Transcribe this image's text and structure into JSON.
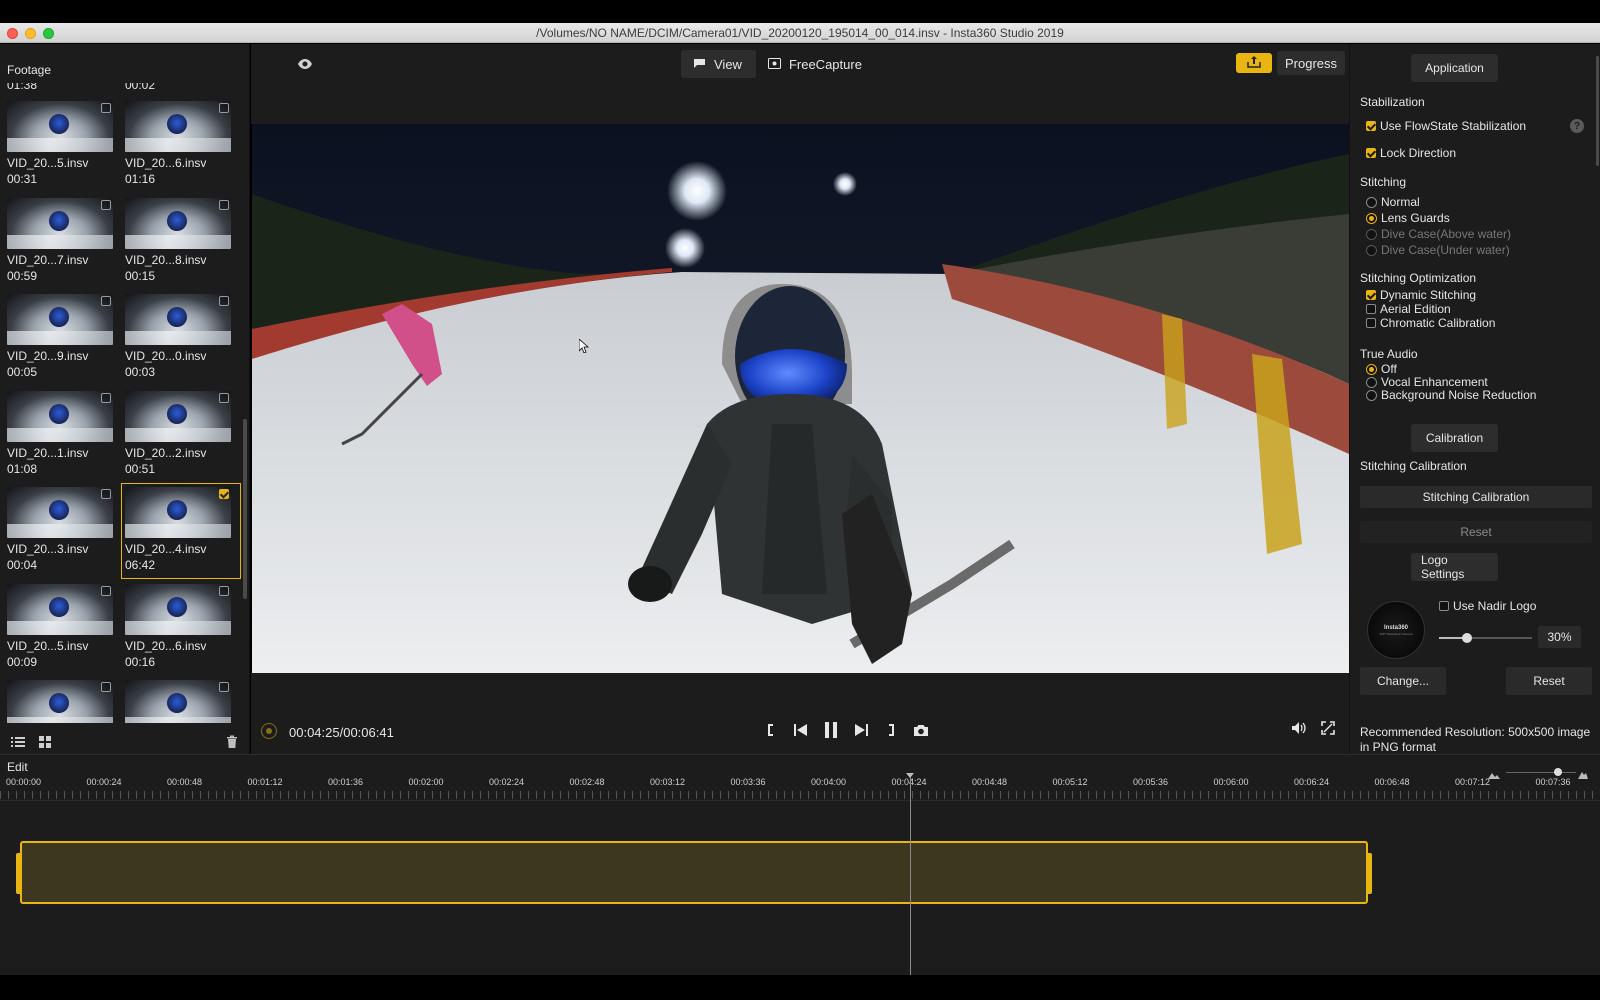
{
  "window": {
    "title": "/Volumes/NO NAME/DCIM/Camera01/VID_20200120_195014_00_014.insv - Insta360 Studio 2019"
  },
  "sidebar": {
    "header": "Footage",
    "top_partial": [
      "01:38",
      "00:02"
    ],
    "thumbnails": [
      {
        "name": "VID_20...5.insv",
        "duration": "00:31",
        "selected": false
      },
      {
        "name": "VID_20...6.insv",
        "duration": "01:16",
        "selected": false
      },
      {
        "name": "VID_20...7.insv",
        "duration": "00:59",
        "selected": false
      },
      {
        "name": "VID_20...8.insv",
        "duration": "00:15",
        "selected": false
      },
      {
        "name": "VID_20...9.insv",
        "duration": "00:05",
        "selected": false
      },
      {
        "name": "VID_20...0.insv",
        "duration": "00:03",
        "selected": false
      },
      {
        "name": "VID_20...1.insv",
        "duration": "01:08",
        "selected": false
      },
      {
        "name": "VID_20...2.insv",
        "duration": "00:51",
        "selected": false
      },
      {
        "name": "VID_20...3.insv",
        "duration": "00:04",
        "selected": false
      },
      {
        "name": "VID_20...4.insv",
        "duration": "06:42",
        "selected": true
      },
      {
        "name": "VID_20...5.insv",
        "duration": "00:09",
        "selected": false
      },
      {
        "name": "VID_20...6.insv",
        "duration": "00:16",
        "selected": false
      },
      {
        "name": "",
        "duration": "",
        "selected": false
      },
      {
        "name": "",
        "duration": "",
        "selected": false
      }
    ]
  },
  "viewer": {
    "tabs": [
      {
        "label": "View",
        "icon": "flag-icon",
        "active": true
      },
      {
        "label": "FreeCapture",
        "icon": "capture-icon",
        "active": false
      }
    ],
    "progress_label": "Progress",
    "timecode": "00:04:25/00:06:41"
  },
  "right_panel": {
    "application_tab": "Application",
    "stabilization": {
      "title": "Stabilization",
      "flowstate": {
        "label": "Use FlowState Stabilization",
        "checked": true
      },
      "lock_direction": {
        "label": "Lock Direction",
        "checked": true
      },
      "help": "?"
    },
    "stitching": {
      "title": "Stitching",
      "options": [
        {
          "label": "Normal",
          "selected": false,
          "disabled": false
        },
        {
          "label": "Lens Guards",
          "selected": true,
          "disabled": false
        },
        {
          "label": "Dive Case(Above water)",
          "selected": false,
          "disabled": true
        },
        {
          "label": "Dive Case(Under water)",
          "selected": false,
          "disabled": true
        }
      ]
    },
    "stitching_optimization": {
      "title": "Stitching Optimization",
      "options": [
        {
          "label": "Dynamic Stitching",
          "checked": true
        },
        {
          "label": "Aerial Edition",
          "checked": false
        },
        {
          "label": "Chromatic Calibration",
          "checked": false
        }
      ]
    },
    "true_audio": {
      "title": "True Audio",
      "options": [
        {
          "label": "Off",
          "selected": true
        },
        {
          "label": "Vocal Enhancement",
          "selected": false
        },
        {
          "label": "Background Noise Reduction",
          "selected": false
        }
      ]
    },
    "calibration_tab": "Calibration",
    "stitching_calibration_title": "Stitching Calibration",
    "stitching_calibration_button": "Stitching Calibration",
    "reset_label": "Reset",
    "logo_tab": "Logo Settings",
    "nadir": {
      "label": "Use Nadir Logo",
      "checked": false
    },
    "logo_brand": "Insta360",
    "logo_sub": "360° Panoramic Camera",
    "opacity_value": "30%",
    "opacity_fraction": 0.3,
    "change_label": "Change...",
    "reset2_label": "Reset",
    "recommended": "Recommended Resolution: 500x500 image in PNG format"
  },
  "timeline": {
    "label": "Edit",
    "ticks": [
      "00:00:00",
      "00:00:24",
      "00:00:48",
      "00:01:12",
      "00:01:36",
      "00:02:00",
      "00:02:24",
      "00:02:48",
      "00:03:12",
      "00:03:36",
      "00:04:00",
      "00:04:24",
      "00:04:48",
      "00:05:12",
      "00:05:36",
      "00:06:00",
      "00:06:24",
      "00:06:48",
      "00:07:12",
      "00:07:36"
    ]
  },
  "colors": {
    "accent": "#e8b512",
    "panel_bg": "#1c1c1c",
    "clip_fill": "#3e3720"
  }
}
